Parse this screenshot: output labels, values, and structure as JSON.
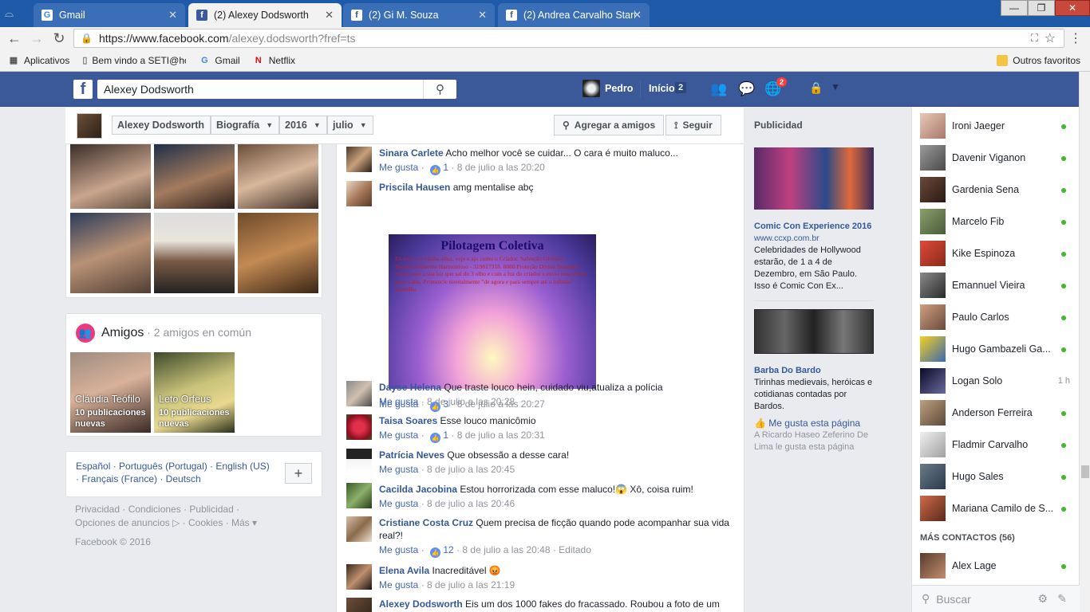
{
  "browser": {
    "tabs": [
      {
        "title": "Gmail",
        "icon": "G"
      },
      {
        "title": "(2) Alexey Dodsworth",
        "icon": "f"
      },
      {
        "title": "(2) Gi M. Souza",
        "icon": "f"
      },
      {
        "title": "(2) Andrea Carvalho Stari",
        "icon": "f"
      }
    ],
    "url_host": "https://www.facebook.com",
    "url_path": "/alexey.dodsworth?fref=ts",
    "bookmarks": [
      "Aplicativos",
      "Bem vindo a SETI@hc",
      "Gmail",
      "Netflix"
    ],
    "other_bookmarks": "Outros favoritos"
  },
  "fb": {
    "search_value": "Alexey Dodsworth",
    "user_name": "Pedro",
    "home_label": "Início",
    "home_count": "2",
    "notif_count": "2"
  },
  "profile_header": {
    "name": "Alexey Dodsworth",
    "section": "Biografía",
    "year": "2016",
    "month": "julio",
    "add_friend": "Agregar a amigos",
    "follow": "Seguir"
  },
  "friends_card": {
    "title": "Amigos",
    "subtitle": " · 2 amigos en común",
    "friends": [
      {
        "name": "Cláudia Teófilo",
        "updates": "10 publicaciones nuevas"
      },
      {
        "name": "Leto Orfeus",
        "updates": "10 publicaciones nuevas"
      }
    ]
  },
  "languages": {
    "line1": "Español · Português (Portugal) · English (US)",
    "line2": "· Français (France) · Deutsch",
    "plus": "+"
  },
  "footer": {
    "line1": "Privacidad · Condiciones · Publicidad ·",
    "line2": "Opciones de anuncios ▷ · Cookies · Más ▾",
    "copyright": "Facebook © 2016"
  },
  "comments": [
    {
      "author": "Sinara Carlete",
      "text": "Acho melhor você se cuidar... O cara é muito maluco...",
      "like_label": "Me gusta",
      "likes": "1",
      "time": "8 de julio a las 20:20",
      "edited": ""
    },
    {
      "author": "Priscila Hausen",
      "text": "amg mentalise abç",
      "like_label": "Me gusta",
      "likes": "3",
      "time": "8 de julio a las 20:27",
      "edited": ""
    },
    {
      "author": "Dayse Helena",
      "text": "Que traste louco hein, cuidado viu,atualiza a polícia",
      "like_label": "Me gusta",
      "likes": "",
      "time": "8 de julio a las 20:28",
      "edited": ""
    },
    {
      "author": "Taisa Soares",
      "text": "Esse louco manicômio",
      "like_label": "Me gusta",
      "likes": "1",
      "time": "8 de julio a las 20:31",
      "edited": ""
    },
    {
      "author": "Patrícia Neves",
      "text": "Que obsessão a desse cara!",
      "like_label": "Me gusta",
      "likes": "",
      "time": "8 de julio a las 20:45",
      "edited": ""
    },
    {
      "author": "Cacilda Jacobina",
      "text": "Estou horrorizada com esse maluco!😱 Xô, coisa ruim!",
      "like_label": "Me gusta",
      "likes": "",
      "time": "8 de julio a las 20:46",
      "edited": ""
    },
    {
      "author": "Cristiane Costa Cruz",
      "text": "Quem precisa de ficção quando pode acompanhar sua vida real?!",
      "like_label": "Me gusta",
      "likes": "12",
      "time": "8 de julio a las 20:48",
      "edited": "Editado"
    },
    {
      "author": "Elena Avila",
      "text": "Inacreditável 😡",
      "like_label": "Me gusta",
      "likes": "",
      "time": "8 de julio a las 21:19",
      "edited": ""
    },
    {
      "author": "Alexey Dodsworth",
      "text": "Eis um dos 1000 fakes do fracassado. Roubou a foto de um",
      "like_label": "",
      "likes": "",
      "time": "",
      "edited": ""
    }
  ],
  "pilot_image": {
    "title": "Pilotagem Coletiva",
    "text": "Eu entro na minha alma, vejo e ajo como o Criador, Salvação Global e Desenvolvimento Harmonioso - 319817318. 8888 Proteção Divina Ilumine a esfera com a sua luz que sai do 3 olho e com a luz do criador e envie essa esfera para o alto. Pronuncie mentalmente \"de agora e para sempre até o infinito\" Gratidão."
  },
  "ads": {
    "header": "Publicidad",
    "ad1": {
      "title": "Comic Con Experience 2016",
      "url": "www.ccxp.com.br",
      "text": "Celebridades de Hollywood estarão, de 1 a 4 de Dezembro, em São Paulo. Isso é Comic Con Ex..."
    },
    "header2": "Publicidad",
    "ad2": {
      "title": "Barba Do Bardo",
      "text": "Tirinhas medievais, heróicas e cotidianas contadas por Bardos.",
      "like": "Me gusta esta página",
      "social": "A Ricardo Haseo Zeferino De Lima le gusta esta página"
    }
  },
  "chat": {
    "contacts": [
      {
        "name": "Ironi Jaeger",
        "status": "online",
        "time": ""
      },
      {
        "name": "Davenir Viganon",
        "status": "online",
        "time": ""
      },
      {
        "name": "Gardenia Sena",
        "status": "online",
        "time": ""
      },
      {
        "name": "Marcelo Fib",
        "status": "online",
        "time": ""
      },
      {
        "name": "Kike Espinoza",
        "status": "online",
        "time": ""
      },
      {
        "name": "Emannuel Vieira",
        "status": "online",
        "time": ""
      },
      {
        "name": "Paulo Carlos",
        "status": "online",
        "time": ""
      },
      {
        "name": "Hugo Gambazeli Ga...",
        "status": "online",
        "time": ""
      },
      {
        "name": "Logan Solo",
        "status": "idle",
        "time": "1 h"
      },
      {
        "name": "Anderson Ferreira",
        "status": "online",
        "time": ""
      },
      {
        "name": "Fladmir Carvalho",
        "status": "online",
        "time": ""
      },
      {
        "name": "Hugo Sales",
        "status": "online",
        "time": ""
      },
      {
        "name": "Mariana Camilo de S...",
        "status": "online",
        "time": ""
      }
    ],
    "more_label": "MÁS CONTACTOS (56)",
    "more_contacts": [
      {
        "name": "Alex Lage",
        "status": "online"
      }
    ],
    "search_placeholder": "Buscar"
  }
}
